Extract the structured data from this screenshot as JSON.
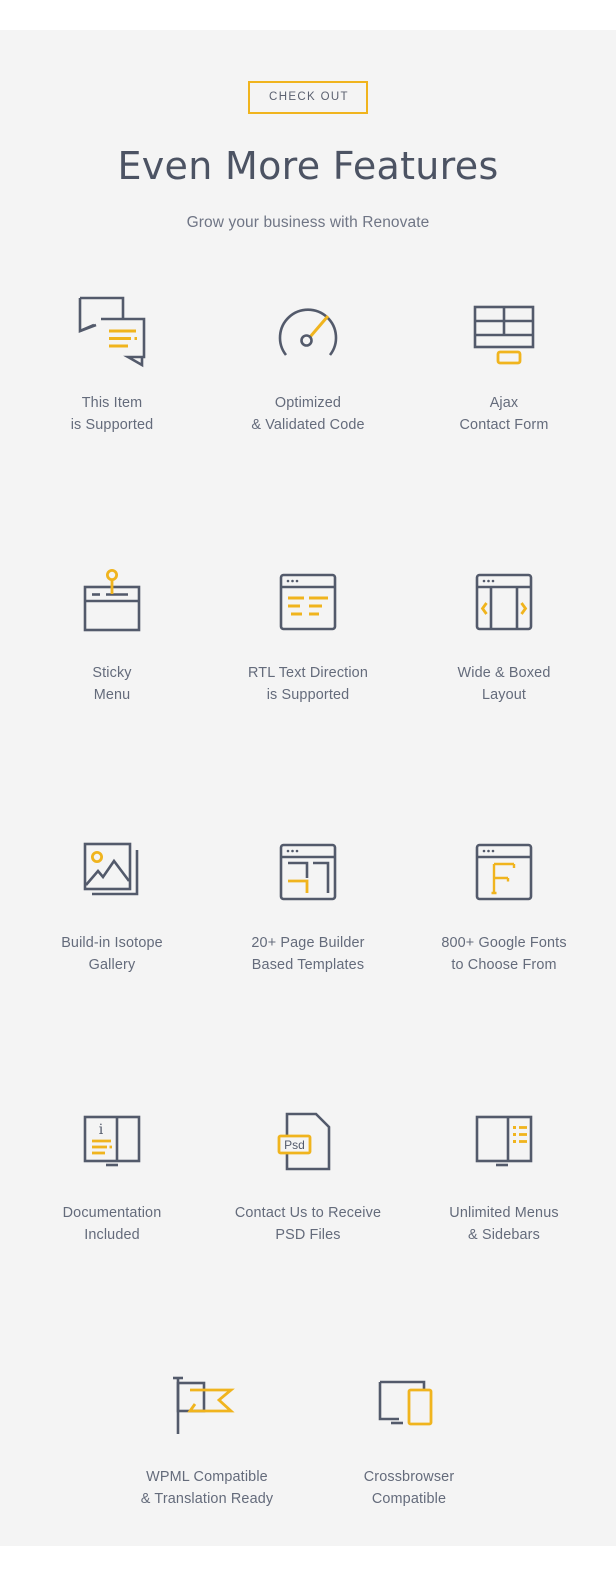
{
  "theme": {
    "page_background": "#ffffff",
    "section_background": "#f4f4f4",
    "accent_color": "#f0b41e",
    "icon_stroke": "#535a6b",
    "title_color": "#4c5363",
    "text_color": "#646b7b"
  },
  "header": {
    "badge_label": "CHECK OUT",
    "title": "Even More Features",
    "subtitle": "Grow your business with Renovate"
  },
  "features": [
    {
      "icon": "chat-bubbles-icon",
      "label": "This Item\nis Supported",
      "line1": "This Item",
      "line2": "is Supported"
    },
    {
      "icon": "speedometer-icon",
      "label": "Optimized\n& Validated Code",
      "line1": "Optimized",
      "line2": "& Validated Code"
    },
    {
      "icon": "contact-form-icon",
      "label": "Ajax\nContact Form",
      "line1": "Ajax",
      "line2": "Contact Form"
    },
    {
      "icon": "pin-window-icon",
      "label": "Sticky\nMenu",
      "line1": "Sticky",
      "line2": "Menu"
    },
    {
      "icon": "rtl-text-window-icon",
      "label": "RTL Text Direction\nis Supported",
      "line1": "RTL Text Direction",
      "line2": "is Supported"
    },
    {
      "icon": "wide-boxed-layout-icon",
      "label": "Wide & Boxed\nLayout",
      "line1": "Wide & Boxed",
      "line2": "Layout"
    },
    {
      "icon": "image-gallery-icon",
      "label": "Build-in Isotope\nGallery",
      "line1": "Build-in Isotope",
      "line2": "Gallery"
    },
    {
      "icon": "page-builder-icon",
      "label": "20+ Page Builder\nBased Templates",
      "line1": "20+ Page Builder",
      "line2": "Based Templates"
    },
    {
      "icon": "font-letter-icon",
      "label": "800+ Google Fonts\nto Choose From",
      "line1": "800+ Google Fonts",
      "line2": "to Choose From",
      "glyph": "F"
    },
    {
      "icon": "documentation-book-icon",
      "label": "Documentation\nIncluded",
      "line1": "Documentation",
      "line2": "Included",
      "glyph": "i"
    },
    {
      "icon": "psd-file-icon",
      "label": "Contact Us to Receive\nPSD Files",
      "line1": "Contact Us to Receive",
      "line2": "PSD Files",
      "glyph": "Psd"
    },
    {
      "icon": "menus-sidebars-icon",
      "label": "Unlimited Menus\n& Sidebars",
      "line1": "Unlimited Menus",
      "line2": "& Sidebars"
    },
    {
      "icon": "flags-icon",
      "label": "WPML Compatible\n& Translation Ready",
      "line1": "WPML Compatible",
      "line2": "& Translation Ready"
    },
    {
      "icon": "devices-icon",
      "label": "Crossbrowser\nCompatible",
      "line1": "Crossbrowser",
      "line2": "Compatible"
    }
  ]
}
